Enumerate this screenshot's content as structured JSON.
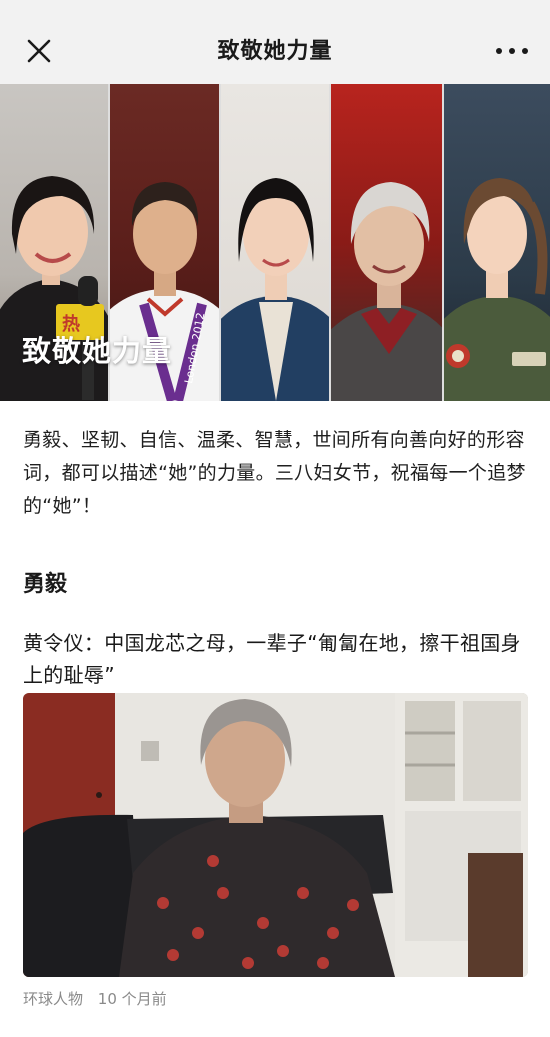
{
  "header": {
    "title": "致敬她力量",
    "close_icon": "close-icon",
    "more_icon": "more-icon"
  },
  "banner": {
    "caption": "致敬她力量",
    "badge_text": "热",
    "medal_ribbon_text": "London 2012"
  },
  "article": {
    "intro": "勇毅、坚韧、自信、温柔、智慧，世间所有向善向好的形容词，都可以描述“她”的力量。三八妇女节，祝福每一个追梦的“她”！",
    "section_heading": "勇毅",
    "story_title": "黄令仪：中国龙芯之母，一辈子“匍匐在地，擦干祖国身上的耻辱”",
    "source_name": "环球人物",
    "time_ago": "10 个月前"
  }
}
